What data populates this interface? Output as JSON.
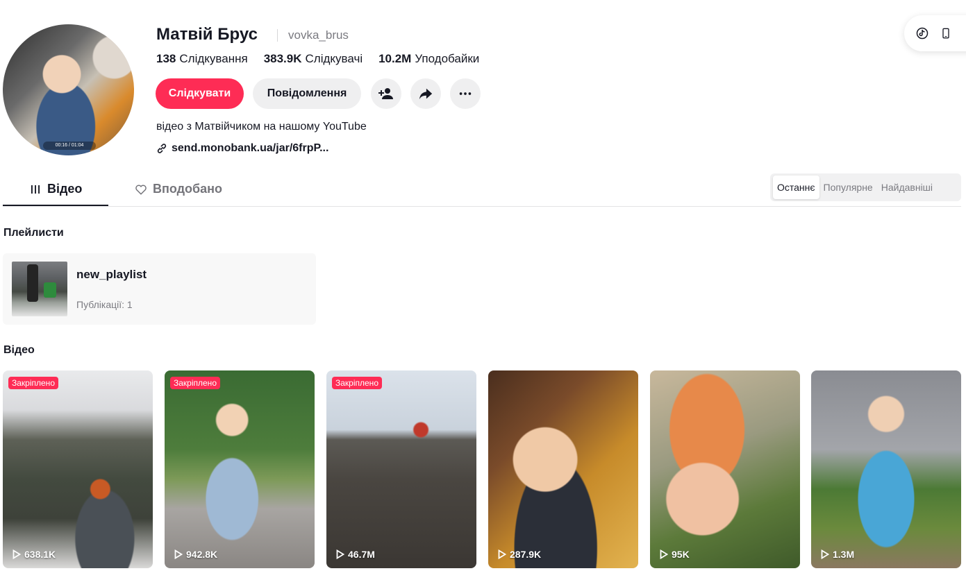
{
  "profile": {
    "name": "Матвій Брус",
    "handle": "vovka_brus",
    "avatar_time": "00:16 / 01:04",
    "stats": [
      {
        "value": "138",
        "label": "Слідкування"
      },
      {
        "value": "383.9K",
        "label": "Слідкувачі"
      },
      {
        "value": "10.2M",
        "label": "Уподобайки"
      }
    ],
    "follow_label": "Слідкувати",
    "message_label": "Повідомлення",
    "bio": "відео з Матвійчиком на нашому YouTube",
    "link": "send.monobank.ua/jar/6frpP..."
  },
  "tabs": {
    "videos": "Відео",
    "liked": "Вподобано"
  },
  "sort": [
    "Останнє",
    "Популярне",
    "Найдавніші"
  ],
  "playlists": {
    "title": "Плейлисти",
    "items": [
      {
        "name": "new_playlist",
        "count": "Публікації: 1"
      }
    ]
  },
  "videos": {
    "title": "Відео",
    "pinned_label": "Закріплено",
    "items": [
      {
        "views": "638.1K",
        "pinned": true
      },
      {
        "views": "942.8K",
        "pinned": true
      },
      {
        "views": "46.7M",
        "pinned": true
      },
      {
        "views": "287.9K",
        "pinned": false
      },
      {
        "views": "95K",
        "pinned": false
      },
      {
        "views": "1.3M",
        "pinned": false
      }
    ]
  },
  "colors": {
    "accent": "#fe2c55",
    "text": "#161823",
    "muted": "#7a7a80"
  }
}
